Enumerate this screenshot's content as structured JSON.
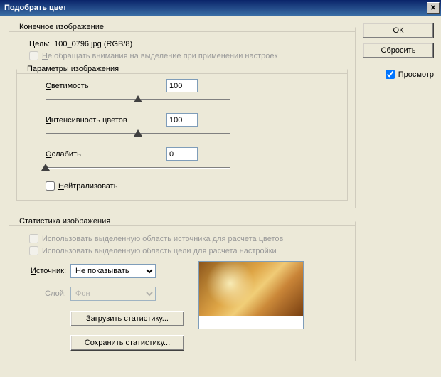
{
  "title": "Подобрать цвет",
  "buttons": {
    "ok": "ОК",
    "reset": "Сбросить",
    "load_stats": "Загрузить статистику...",
    "save_stats": "Сохранить статистику..."
  },
  "preview": {
    "label": "Просмотр",
    "checked": true,
    "underline": "П"
  },
  "dest": {
    "legend": "Конечное изображение",
    "target_label": "Цель:",
    "target_value": "100_0796.jpg (RGB/8)",
    "ignore_selection": {
      "label": "Не обращать внимания на выделение при применении настроек",
      "underline": "Н",
      "checked": false,
      "enabled": false
    }
  },
  "params": {
    "legend": "Параметры изображения",
    "luminance": {
      "label": "Светимость",
      "underline": "С",
      "value": "100",
      "pos": 50
    },
    "intensity": {
      "label": "Интенсивность цветов",
      "underline": "И",
      "value": "100",
      "pos": 50
    },
    "fade": {
      "label": "Ослабить",
      "underline": "О",
      "value": "0",
      "pos": 0
    },
    "neutralize": {
      "label": "Нейтрализовать",
      "underline": "Н",
      "checked": false
    }
  },
  "stats": {
    "legend": "Статистика изображения",
    "use_src_selection": {
      "label": "Использовать выделенную область источника для расчета цветов",
      "checked": false,
      "enabled": false
    },
    "use_tgt_selection": {
      "label": "Использовать выделенную область цели для расчета настройки",
      "checked": false,
      "enabled": false
    },
    "source_label": "Источник:",
    "source_underline": "И",
    "source_value": "Не показывать",
    "source_options": [
      "Не показывать"
    ],
    "layer_label": "Слой:",
    "layer_underline": "С",
    "layer_value": "Фон",
    "layer_options": [
      "Фон"
    ],
    "layer_enabled": false
  }
}
